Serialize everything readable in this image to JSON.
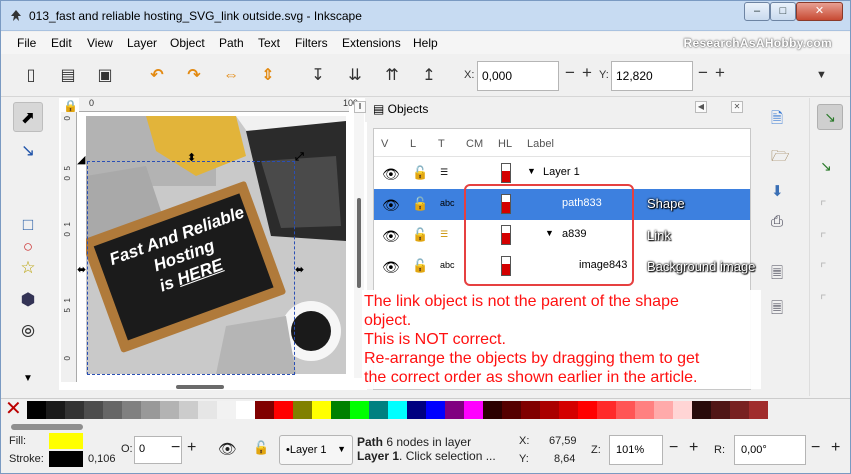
{
  "window": {
    "title": "013_fast and reliable hosting_SVG_link outside.svg - Inkscape",
    "buttons": {
      "minimize": "–",
      "maximize": "□",
      "close": "✕"
    }
  },
  "menu": [
    "File",
    "Edit",
    "View",
    "Layer",
    "Object",
    "Path",
    "Text",
    "Filters",
    "Extensions",
    "Help"
  ],
  "watermark": "ResearchAsAHobby.com",
  "toolbar": {
    "x_label": "X:",
    "x_value": "0,000",
    "y_label": "Y:",
    "y_value": "12,820",
    "minus": "−",
    "plus": "+",
    "more": "▼"
  },
  "canvas": {
    "ruler_top": [
      "0",
      "100"
    ],
    "ruler_left": [
      "0",
      "5",
      "0",
      "1",
      "0",
      "1",
      "5",
      "0",
      "2",
      "0",
      "5"
    ],
    "board_lines": [
      "Fast And Reliable",
      "Hosting",
      "is",
      "HERE"
    ]
  },
  "objects_panel": {
    "title": "Objects",
    "columns": [
      "V",
      "L",
      "T",
      "CM",
      "HL",
      "Label"
    ],
    "rows": [
      {
        "label": "Layer 1",
        "expander": "▼",
        "annotation": ""
      },
      {
        "label": "path833",
        "expander": "",
        "annotation": "Shape"
      },
      {
        "label": "a839",
        "expander": "▼",
        "annotation": "Link"
      },
      {
        "label": "image843",
        "expander": "",
        "annotation": "Background image"
      }
    ],
    "type_abc": "abc"
  },
  "annotation": {
    "lines": [
      "The link object is not the parent of the shape",
      "object.",
      "This is NOT correct.",
      "Re-arrange the objects by dragging them to get",
      "the correct order as shown earlier in the article."
    ],
    "color": "#ff1010"
  },
  "palette": {
    "colors": [
      "#000000",
      "#1a1a1a",
      "#333333",
      "#4d4d4d",
      "#666666",
      "#808080",
      "#999999",
      "#b3b3b3",
      "#cccccc",
      "#e6e6e6",
      "#f2f2f2",
      "#ffffff",
      "#800000",
      "#ff0000",
      "#808000",
      "#ffff00",
      "#008000",
      "#00ff00",
      "#008080",
      "#00ffff",
      "#000080",
      "#0000ff",
      "#800080",
      "#ff00ff",
      "#2b0000",
      "#550000",
      "#800000",
      "#aa0000",
      "#d40000",
      "#ff0000",
      "#ff2a2a",
      "#ff5555",
      "#ff8080",
      "#ffaaaa",
      "#ffd5d5",
      "#280b0b",
      "#501616",
      "#782121",
      "#a02c2c"
    ]
  },
  "status": {
    "fill_label": "Fill:",
    "stroke_label": "Stroke:",
    "stroke_width": "0,106",
    "opacity_label": "O:",
    "opacity_value": "0",
    "layer_name": "•Layer 1",
    "message_line1_bold": "Path",
    "message_line1": " 6 nodes in layer",
    "message_line2_bold": "Layer 1",
    "message_line2": ". Click selection ...",
    "cursor_x_label": "X:",
    "cursor_x": "67,59",
    "cursor_y_label": "Y:",
    "cursor_y": "8,64",
    "zoom_label": "Z:",
    "zoom": "101%",
    "rotation_label": "R:",
    "rotation": "0,00°"
  },
  "colors": {
    "selection_blue": "#3d80df",
    "annotation_red": "#ff1010",
    "highlight_box": "#e64040"
  }
}
